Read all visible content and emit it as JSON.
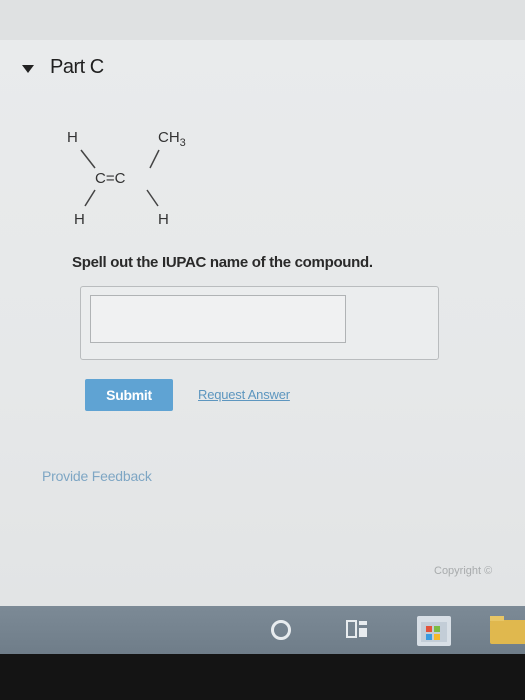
{
  "part": {
    "title": "Part C"
  },
  "molecule": {
    "top_left": "H",
    "top_right": "CH",
    "top_right_subscript": "3",
    "center": "C=C",
    "bottom_left": "H",
    "bottom_right": "H"
  },
  "question": {
    "text": "Spell out the IUPAC name of the compound."
  },
  "answer": {
    "value": ""
  },
  "actions": {
    "submit_label": "Submit",
    "request_answer_label": "Request Answer"
  },
  "feedback": {
    "label": "Provide Feedback"
  },
  "footer": {
    "copyright": "Copyright ©"
  },
  "colors": {
    "submit": "#5fa3d3",
    "link": "#5d96bf",
    "taskbar": "#77858f"
  }
}
